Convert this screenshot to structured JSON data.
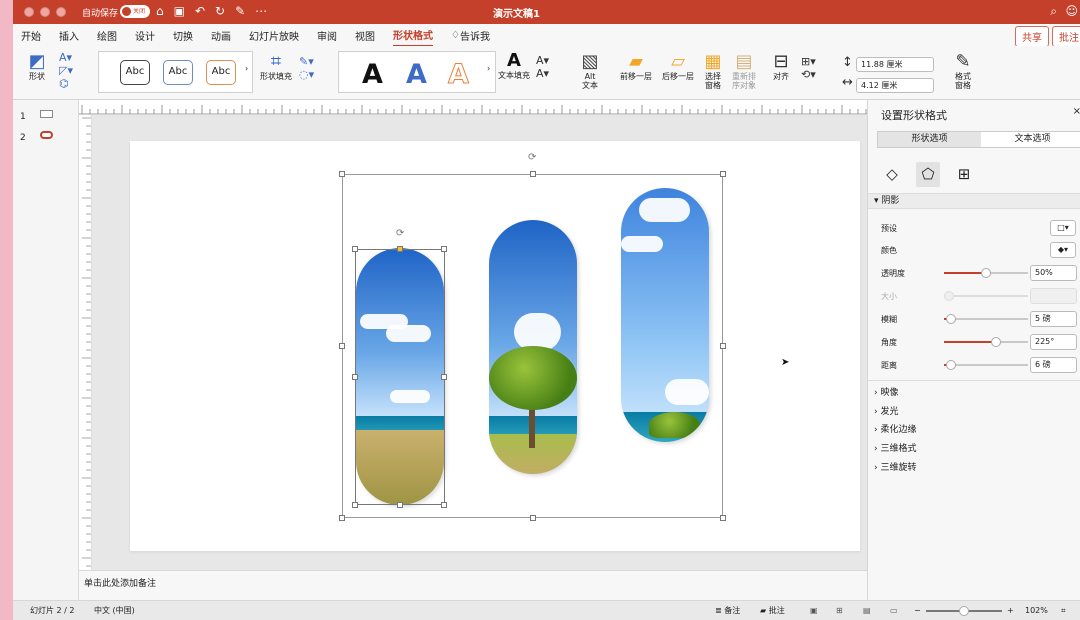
{
  "titlebar": {
    "autosave_label": "自动保存",
    "autosave_toggle": "关闭",
    "document_title": "演示文稿1",
    "icons": [
      "home-icon",
      "save-icon",
      "undo-icon",
      "redo-icon",
      "edit-icon",
      "more-icon",
      "search-icon",
      "user-icon"
    ]
  },
  "tabs": [
    "开始",
    "插入",
    "绘图",
    "设计",
    "切换",
    "动画",
    "幻灯片放映",
    "审阅",
    "视图",
    "形状格式"
  ],
  "tell_me": "告诉我",
  "top_buttons": {
    "share": "共享",
    "comment": "批注"
  },
  "ribbon": {
    "shape": "形状",
    "style_labels": [
      "Abc",
      "Abc",
      "Abc"
    ],
    "shape_fill": "形状填充",
    "text_letters": [
      "A",
      "A",
      "A"
    ],
    "text_fill": "文本填充",
    "alt_text_line1": "Alt",
    "alt_text_line2": "文本",
    "bring_forward": "前移一层",
    "send_backward": "后移一层",
    "selection_pane_line1": "选择",
    "selection_pane_line2": "窗格",
    "reorder_line1": "重新排",
    "reorder_line2": "序对象",
    "align": "对齐",
    "height": "11.88 厘米",
    "width": "4.12 厘米",
    "format_pane_line1": "格式",
    "format_pane_line2": "窗格"
  },
  "slides": [
    {
      "number": "1"
    },
    {
      "number": "2"
    }
  ],
  "notes": "单击此处添加备注",
  "status": {
    "slide": "幻灯片 2 / 2",
    "language": "中文 (中国)",
    "notes": "备注",
    "comments": "批注",
    "zoom": "102%",
    "zoom_value": 0.5
  },
  "pane": {
    "title": "设置形状格式",
    "tab_shape": "形状选项",
    "tab_text": "文本选项",
    "shadow": "阴影",
    "preset": "预设",
    "color": "颜色",
    "transparency": "透明度",
    "transparency_value": "50%",
    "transparency_level": 0.5,
    "size": "大小",
    "blur": "模糊",
    "blur_value": "5 磅",
    "blur_level": 0.08,
    "angle": "角度",
    "angle_value": "225°",
    "angle_level": 0.62,
    "distance": "距离",
    "distance_value": "6 磅",
    "distance_level": 0.08,
    "collapsed_sections": [
      "映像",
      "发光",
      "柔化边缘",
      "三维格式",
      "三维旋转"
    ]
  },
  "colors": {
    "accent": "#c4402a",
    "ribbon_blue": "#3e6bc8"
  }
}
